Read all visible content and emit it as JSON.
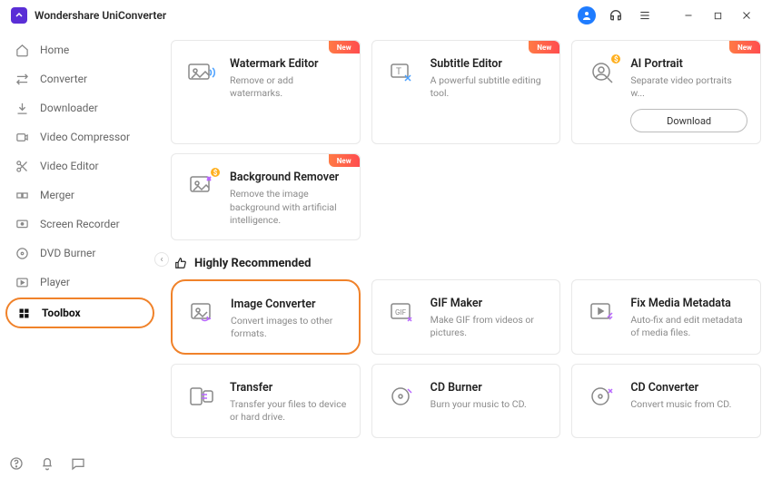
{
  "app": {
    "title": "Wondershare UniConverter"
  },
  "sidebar": {
    "items": [
      {
        "label": "Home"
      },
      {
        "label": "Converter"
      },
      {
        "label": "Downloader"
      },
      {
        "label": "Video Compressor"
      },
      {
        "label": "Video Editor"
      },
      {
        "label": "Merger"
      },
      {
        "label": "Screen Recorder"
      },
      {
        "label": "DVD Burner"
      },
      {
        "label": "Player"
      },
      {
        "label": "Toolbox"
      }
    ]
  },
  "labels": {
    "new": "New",
    "download": "Download",
    "highly_recommended": "Highly Recommended"
  },
  "row1": [
    {
      "title": "Watermark Editor",
      "desc": "Remove or add watermarks."
    },
    {
      "title": "Subtitle Editor",
      "desc": "A powerful subtitle editing tool."
    },
    {
      "title": "AI Portrait",
      "desc": "Separate video portraits w..."
    }
  ],
  "row2": [
    {
      "title": "Background Remover",
      "desc": "Remove the image background with artificial intelligence."
    }
  ],
  "rec": [
    {
      "title": "Image Converter",
      "desc": "Convert images to other formats."
    },
    {
      "title": "GIF Maker",
      "desc": "Make GIF from videos or pictures."
    },
    {
      "title": "Fix Media Metadata",
      "desc": "Auto-fix and edit metadata of media files."
    }
  ],
  "row4": [
    {
      "title": "Transfer",
      "desc": "Transfer your files to device or hard drive."
    },
    {
      "title": "CD Burner",
      "desc": "Burn your music to CD."
    },
    {
      "title": "CD Converter",
      "desc": "Convert music from CD."
    }
  ]
}
